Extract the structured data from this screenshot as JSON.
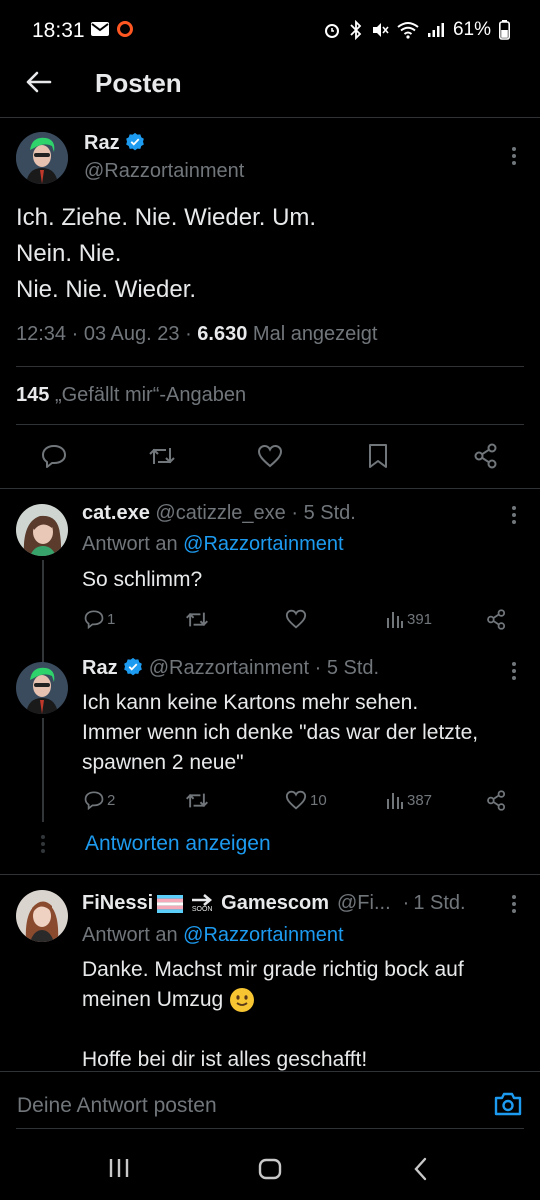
{
  "status_bar": {
    "time": "18:31",
    "battery": "61%"
  },
  "header": {
    "title": "Posten"
  },
  "main_post": {
    "author_name": "Raz",
    "handle": "@Razzortainment",
    "lines": [
      "Ich. Ziehe. Nie. Wieder. Um.",
      "Nein. Nie.",
      "Nie. Nie. Wieder."
    ],
    "time": "12:34",
    "date": "03 Aug. 23",
    "views_count": "6.630",
    "views_label": "Mal angezeigt",
    "likes_count": "145",
    "likes_label": "„Gefällt mir“-Angaben"
  },
  "replies": [
    {
      "author_name": "cat.exe",
      "handle": "@catizzle_exe",
      "time": "5 Std.",
      "reply_to_prefix": "Antwort an",
      "reply_to": "@Razzortainment",
      "text": "So schlimm?",
      "reply_count": "1",
      "retweet_count": "",
      "like_count": "",
      "view_count": "391"
    },
    {
      "author_name": "Raz",
      "handle": "@Razzortainment",
      "time": "5 Std.",
      "lines": [
        "Ich kann keine Kartons mehr sehen.",
        "Immer wenn ich denke \"das war der letzte,",
        "spawnen 2 neue\""
      ],
      "reply_count": "2",
      "like_count": "10",
      "view_count": "387"
    },
    {
      "author_name": "FiNessi",
      "name_suffix": "Gamescom",
      "soon_label": "SOON",
      "handle": "@Fi...",
      "time": "1 Std.",
      "reply_to_prefix": "Antwort an",
      "reply_to": "@Razzortainment",
      "lines": [
        "Danke. Machst mir grade richtig bock auf",
        "meinen Umzug",
        "",
        "Hoffe bei dir ist alles geschafft!"
      ]
    }
  ],
  "show_replies_label": "Antworten anzeigen",
  "compose": {
    "placeholder": "Deine Antwort posten"
  },
  "colors": {
    "accent": "#1d9bf0",
    "background": "#000000",
    "text": "#e7e9ea",
    "muted": "#71767b",
    "divider": "#2f3336"
  }
}
